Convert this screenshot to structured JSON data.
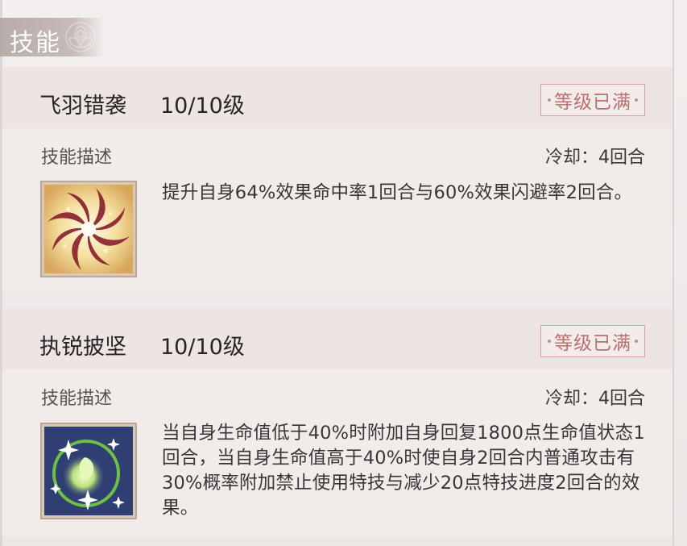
{
  "section": {
    "title": "技能"
  },
  "skills": [
    {
      "name": "飞羽错袭",
      "level": "10/10级",
      "badge": "等级已满",
      "desc_label": "技能描述",
      "cooldown": "冷却：4回合",
      "description": "提升自身64%效果命中率1回合与60%效果闪避率2回合。",
      "icon": "feather-swirl-icon",
      "colors": {
        "icon_bg": "#f4e2a8",
        "icon_accent": "#8b2230"
      }
    },
    {
      "name": "执锐披坚",
      "level": "10/10级",
      "badge": "等级已满",
      "desc_label": "技能描述",
      "cooldown": "冷却：4回合",
      "description": "当自身生命值低于40%时附加自身回复1800点生命值状态1回合，当自身生命值高于40%时使自身2回合内普通攻击有30%概率附加禁止使用特技与减少20点特技进度2回合的效果。",
      "icon": "sparkle-orb-icon",
      "colors": {
        "icon_bg": "#2f3f73",
        "icon_accent": "#8fd14f"
      }
    }
  ],
  "colors": {
    "badge_text": "#b9716f",
    "badge_border": "#d3a3a3",
    "header_tab": "#b8aca9"
  }
}
